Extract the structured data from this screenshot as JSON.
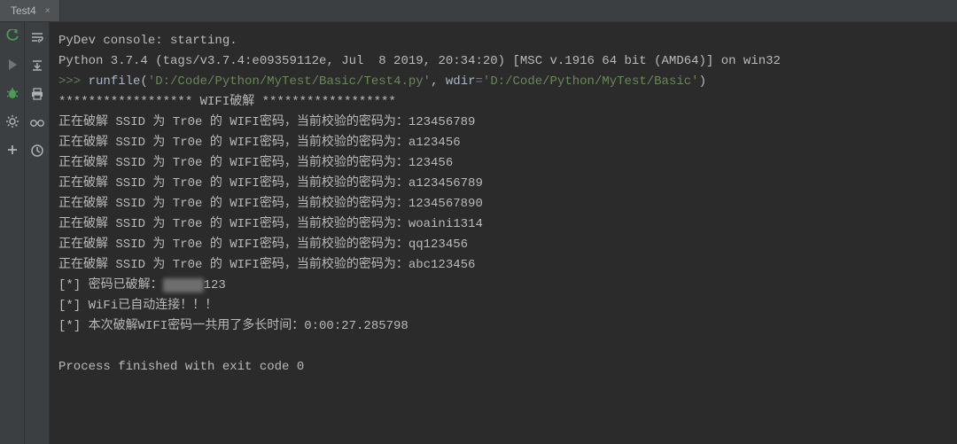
{
  "tab": {
    "label": "Test4",
    "close": "×"
  },
  "left_icons": [
    "rerun",
    "play",
    "debug",
    "settings",
    "add"
  ],
  "right_icons": [
    "soft-wrap",
    "scroll-end",
    "print",
    "spectacles",
    "history"
  ],
  "console": {
    "l0": "PyDev console: starting.",
    "l1": "",
    "l2": "Python 3.7.4 (tags/v3.7.4:e09359112e, Jul  8 2019, 20:34:20) [MSC v.1916 64 bit (AMD64)] on win32",
    "prompt": ">>> ",
    "fn": "runfile",
    "lp": "(",
    "arg1": "'D:/Code/Python/MyTest/Basic/Test4.py'",
    "comma": ", ",
    "kw": "wdir",
    "eq": "=",
    "arg2": "'D:/Code/Python/MyTest/Basic'",
    "rp": ")",
    "banner": "****************** WIFI破解 ******************",
    "pre": "正在破解 SSID 为 Tr0e 的 WIFI密码，当前校验的密码为：",
    "p0": "123456789",
    "p1": "a123456",
    "p2": "123456",
    "p3": "a123456789",
    "p4": "1234567890",
    "p5": "woaini1314",
    "p6": "qq123456",
    "p7": "abc123456",
    "r0a": "[*] 密码已破解：",
    "r0_hidden": "xxxxx",
    "r0b": "123",
    "r1": "[*] WiFi已自动连接！！！",
    "r2": "[*] 本次破解WIFI密码一共用了多长时间：0:00:27.285798",
    "exit": "Process finished with exit code 0"
  }
}
